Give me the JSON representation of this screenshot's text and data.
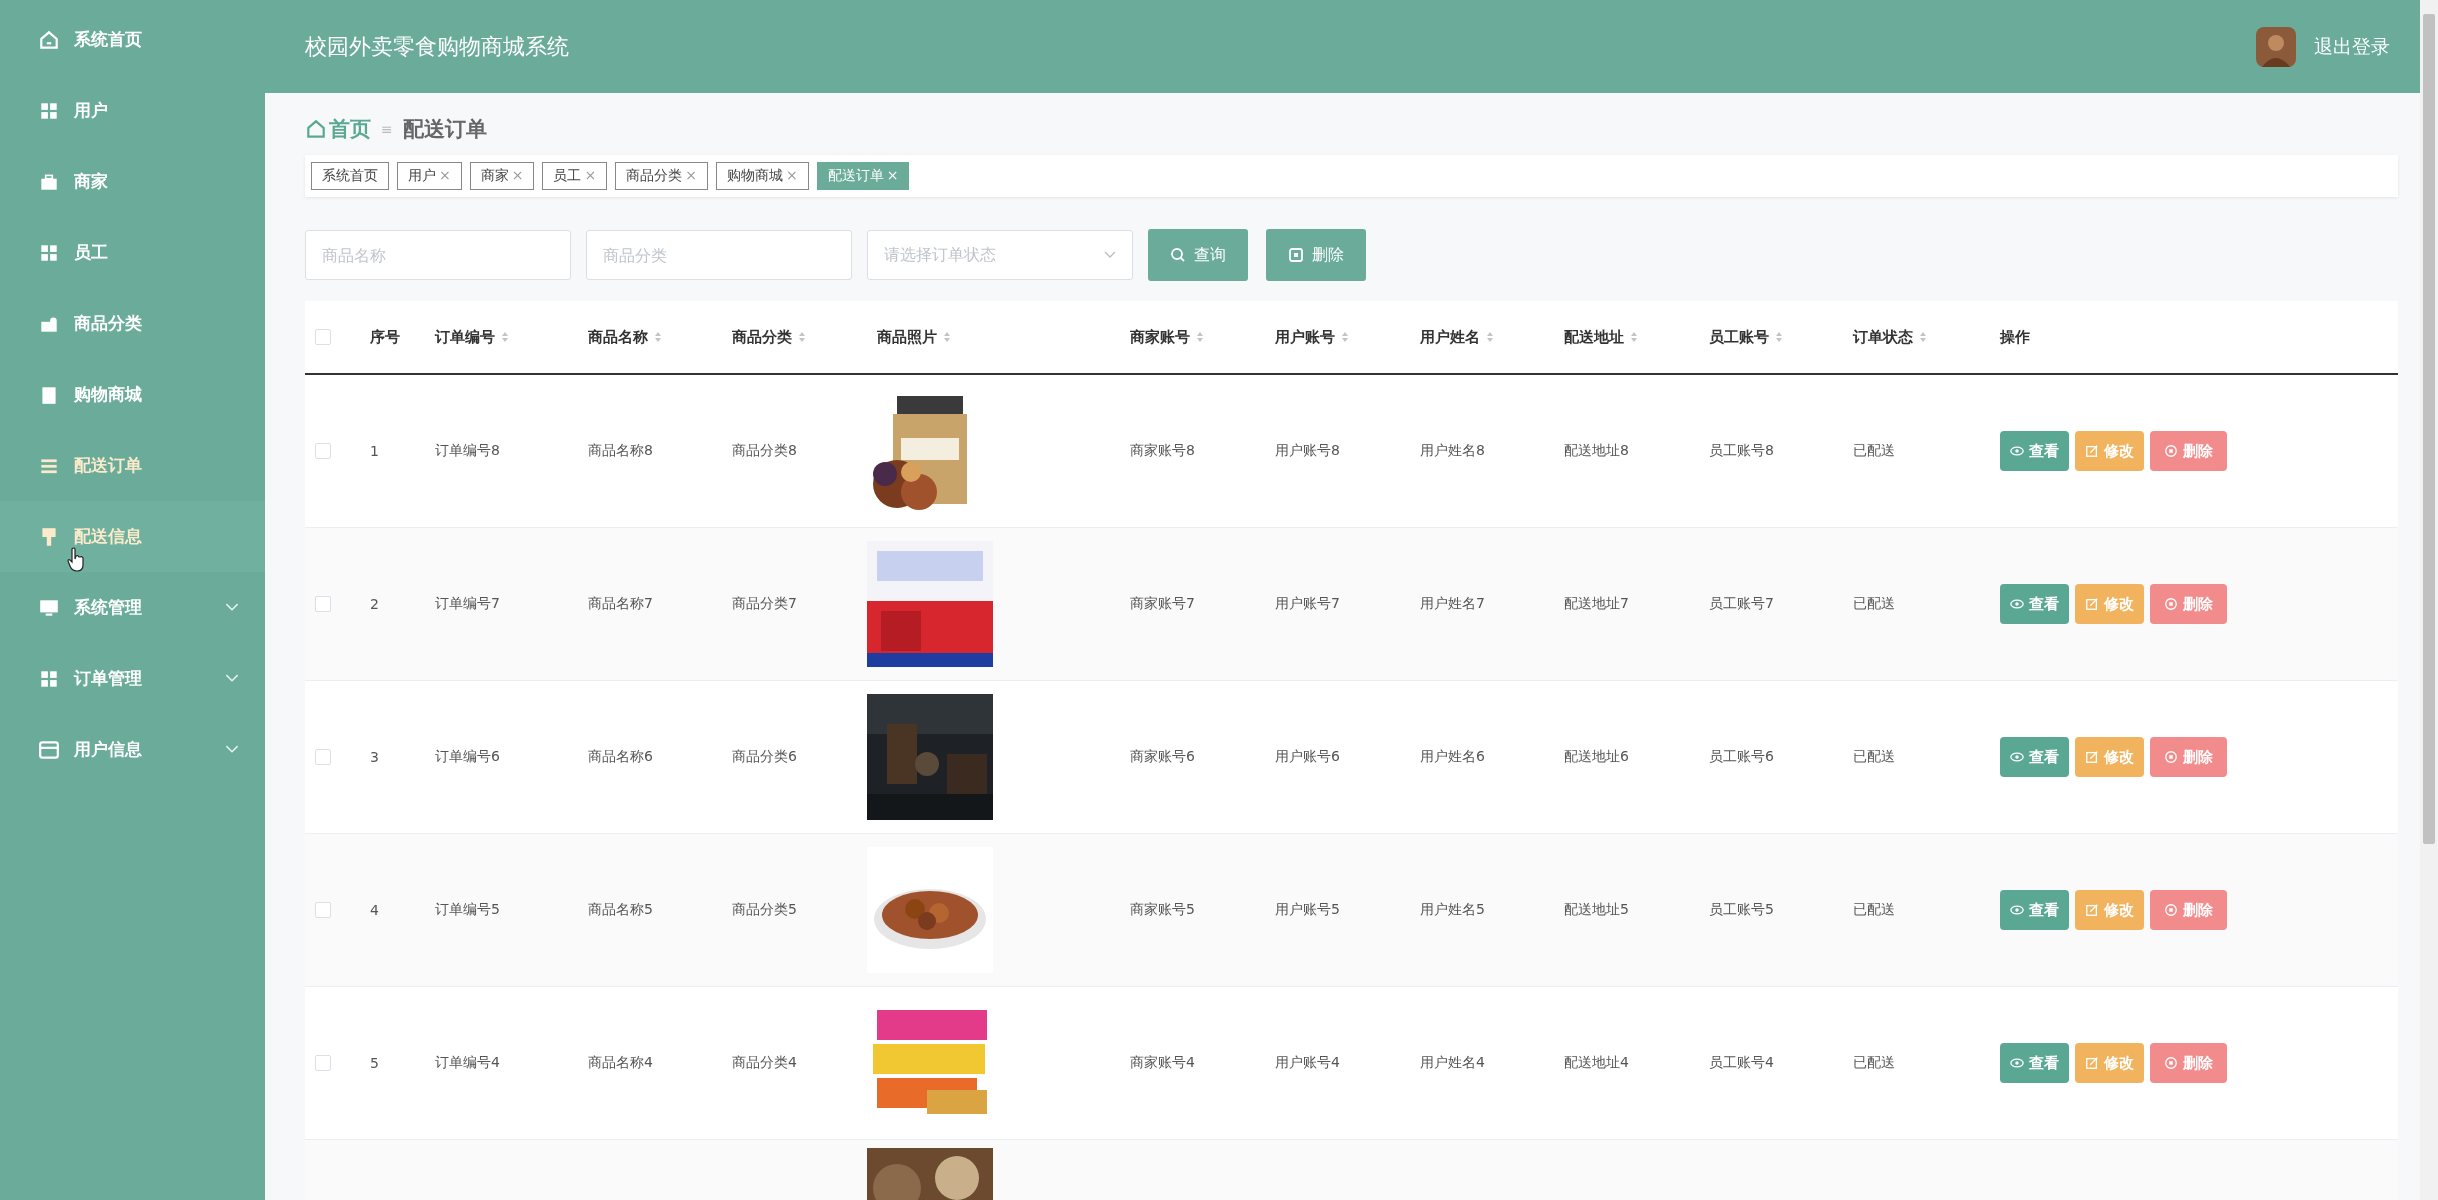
{
  "sidebar": {
    "items": [
      {
        "label": "系统首页",
        "selected": false,
        "hovered": false,
        "expandable": false
      },
      {
        "label": "用户",
        "selected": false,
        "hovered": false,
        "expandable": false
      },
      {
        "label": "商家",
        "selected": false,
        "hovered": false,
        "expandable": false
      },
      {
        "label": "员工",
        "selected": false,
        "hovered": false,
        "expandable": false
      },
      {
        "label": "商品分类",
        "selected": false,
        "hovered": false,
        "expandable": false
      },
      {
        "label": "购物商城",
        "selected": false,
        "hovered": false,
        "expandable": false
      },
      {
        "label": "配送订单",
        "selected": true,
        "hovered": false,
        "expandable": false
      },
      {
        "label": "配送信息",
        "selected": false,
        "hovered": true,
        "expandable": false
      },
      {
        "label": "系统管理",
        "selected": false,
        "hovered": false,
        "expandable": true
      },
      {
        "label": "订单管理",
        "selected": false,
        "hovered": false,
        "expandable": true
      },
      {
        "label": "用户信息",
        "selected": false,
        "hovered": false,
        "expandable": true
      }
    ]
  },
  "header": {
    "title": "校园外卖零食购物商城系统",
    "logout": "退出登录"
  },
  "breadcrumb": {
    "home": "首页",
    "separator": "≡",
    "current": "配送订单"
  },
  "tabs": [
    {
      "label": "系统首页",
      "selected": false
    },
    {
      "label": "用户",
      "close": "×",
      "selected": false
    },
    {
      "label": "商家",
      "close": "×",
      "selected": false
    },
    {
      "label": "员工",
      "close": "×",
      "selected": false
    },
    {
      "label": "商品分类",
      "close": "×",
      "selected": false
    },
    {
      "label": "购物商城",
      "close": "×",
      "selected": false
    },
    {
      "label": "配送订单",
      "close": "×",
      "selected": true
    }
  ],
  "search": {
    "fields": [
      {
        "placeholder": "商品名称"
      },
      {
        "placeholder": "商品分类"
      }
    ],
    "status_select": {
      "placeholder": "请选择订单状态"
    },
    "query_button": "查询",
    "delete_button": "删除"
  },
  "table": {
    "select_all_checked": false,
    "columns": [
      {
        "label": "序号",
        "sortable": false
      },
      {
        "label": "订单编号",
        "sortable": true
      },
      {
        "label": "商品名称",
        "sortable": true
      },
      {
        "label": "商品分类",
        "sortable": true
      },
      {
        "label": "商品照片",
        "sortable": true
      },
      {
        "label": "商家账号",
        "sortable": true
      },
      {
        "label": "用户账号",
        "sortable": true
      },
      {
        "label": "用户姓名",
        "sortable": true
      },
      {
        "label": "配送地址",
        "sortable": true
      },
      {
        "label": "员工账号",
        "sortable": true
      },
      {
        "label": "订单状态",
        "sortable": true
      },
      {
        "label": "操作",
        "sortable": false
      }
    ],
    "rows": [
      {
        "checked": false,
        "cells": [
          "1",
          "订单编号8",
          "商品名称8",
          "商品分类8"
        ],
        "cells_after": [
          "商家账号8",
          "用户账号8",
          "用户姓名8",
          "配送地址8",
          "员工账号8",
          "已配送"
        ],
        "actions": [
          {
            "kind": "view",
            "label": "查看"
          },
          {
            "kind": "edit",
            "label": "修改"
          },
          {
            "kind": "delete",
            "label": "删除"
          }
        ]
      },
      {
        "checked": false,
        "cells": [
          "2",
          "订单编号7",
          "商品名称7",
          "商品分类7"
        ],
        "cells_after": [
          "商家账号7",
          "用户账号7",
          "用户姓名7",
          "配送地址7",
          "员工账号7",
          "已配送"
        ],
        "actions": [
          {
            "kind": "view",
            "label": "查看"
          },
          {
            "kind": "edit",
            "label": "修改"
          },
          {
            "kind": "delete",
            "label": "删除"
          }
        ]
      },
      {
        "checked": false,
        "cells": [
          "3",
          "订单编号6",
          "商品名称6",
          "商品分类6"
        ],
        "cells_after": [
          "商家账号6",
          "用户账号6",
          "用户姓名6",
          "配送地址6",
          "员工账号6",
          "已配送"
        ],
        "actions": [
          {
            "kind": "view",
            "label": "查看"
          },
          {
            "kind": "edit",
            "label": "修改"
          },
          {
            "kind": "delete",
            "label": "删除"
          }
        ]
      },
      {
        "checked": false,
        "cells": [
          "4",
          "订单编号5",
          "商品名称5",
          "商品分类5"
        ],
        "cells_after": [
          "商家账号5",
          "用户账号5",
          "用户姓名5",
          "配送地址5",
          "员工账号5",
          "已配送"
        ],
        "actions": [
          {
            "kind": "view",
            "label": "查看"
          },
          {
            "kind": "edit",
            "label": "修改"
          },
          {
            "kind": "delete",
            "label": "删除"
          }
        ]
      },
      {
        "checked": false,
        "cells": [
          "5",
          "订单编号4",
          "商品名称4",
          "商品分类4"
        ],
        "cells_after": [
          "商家账号4",
          "用户账号4",
          "用户姓名4",
          "配送地址4",
          "员工账号4",
          "已配送"
        ],
        "actions": [
          {
            "kind": "view",
            "label": "查看"
          },
          {
            "kind": "edit",
            "label": "修改"
          },
          {
            "kind": "delete",
            "label": "删除"
          }
        ]
      },
      {
        "partial": true
      }
    ]
  }
}
